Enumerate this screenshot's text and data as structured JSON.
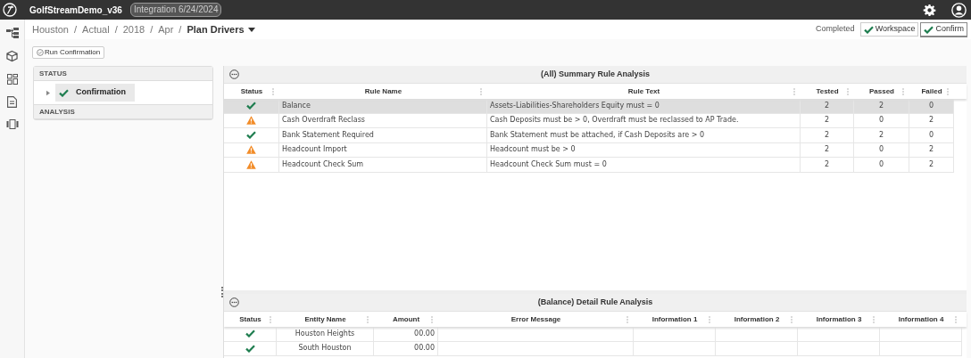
{
  "top_bar": {
    "app_name": "GolfStreamDemo_v36",
    "environment": "Integration 6/24/2024"
  },
  "breadcrumb": {
    "items": [
      {
        "kind": "link",
        "text": "Houston"
      },
      {
        "kind": "separator",
        "text": "/"
      },
      {
        "kind": "link",
        "text": "Actual"
      },
      {
        "kind": "separator",
        "text": "/"
      },
      {
        "kind": "link",
        "text": "2018"
      },
      {
        "kind": "separator",
        "text": "/"
      },
      {
        "kind": "link",
        "text": "Apr"
      },
      {
        "kind": "separator",
        "text": "/"
      },
      {
        "kind": "current",
        "text": "Plan Drivers"
      }
    ]
  },
  "workflow": {
    "status": "Completed",
    "steps": [
      {
        "label": "Workspace",
        "selected": false
      },
      {
        "label": "Confirm",
        "selected": true
      }
    ]
  },
  "toolbar": {
    "run_button": "Run Confirmation"
  },
  "left_panel": {
    "sections": [
      {
        "title": "STATUS",
        "items": [
          {
            "label": "Confirmation",
            "kind": "pass",
            "selected": true,
            "expanded": false
          }
        ]
      },
      {
        "title": "ANALYSIS"
      }
    ]
  },
  "summary": {
    "title": "(All) Summary Rule Analysis",
    "columns": [
      "Status",
      "Rule Name",
      "Rule Text",
      "Tested",
      "Passed",
      "Failed"
    ],
    "rows": [
      {
        "kind": "pass",
        "selected": true,
        "rule_name": "Balance",
        "rule_text": "Assets-Liabilities-Shareholders Equity must = 0",
        "tested": "2",
        "passed": "2",
        "failed": "0"
      },
      {
        "kind": "warning",
        "selected": false,
        "rule_name": "Cash Overdraft Reclass",
        "rule_text": "Cash Deposits must be > 0, Overdraft must be reclassed to AP Trade.",
        "tested": "2",
        "passed": "0",
        "failed": "2"
      },
      {
        "kind": "pass",
        "selected": false,
        "rule_name": "Bank Statement Required",
        "rule_text": "Bank Statement must be attached, if Cash Deposits are > 0",
        "tested": "2",
        "passed": "2",
        "failed": "0"
      },
      {
        "kind": "warning",
        "selected": false,
        "rule_name": "Headcount Import",
        "rule_text": "Headcount must be > 0",
        "tested": "2",
        "passed": "0",
        "failed": "2"
      },
      {
        "kind": "warning",
        "selected": false,
        "rule_name": "Headcount Check Sum",
        "rule_text": "Headcount Check Sum must = 0",
        "tested": "2",
        "passed": "0",
        "failed": "2"
      }
    ]
  },
  "detail": {
    "title": "(Balance) Detail Rule Analysis",
    "columns": [
      "Status",
      "Entity Name",
      "Amount",
      "Error Message",
      "Information 1",
      "Information 2",
      "Information 3",
      "Information 4"
    ],
    "rows": [
      {
        "kind": "pass",
        "entity_name": "Houston Heights",
        "amount": "00.00"
      },
      {
        "kind": "pass",
        "entity_name": "South Houston",
        "amount": "00.00"
      }
    ]
  }
}
